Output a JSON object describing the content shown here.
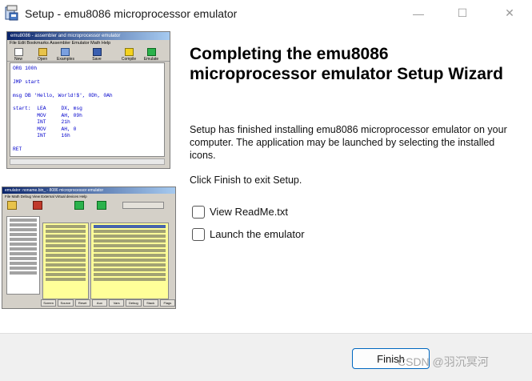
{
  "window": {
    "title": "Setup - emu8086 microprocessor emulator",
    "minimize_glyph": "—",
    "maximize_glyph": "☐",
    "close_glyph": "✕"
  },
  "wizard": {
    "heading": "Completing the emu8086 microprocessor emulator Setup Wizard",
    "body": "Setup has finished installing emu8086 microprocessor emulator on your computer. The application may be launched by selecting the installed icons.",
    "finish_instruction": "Click Finish to exit Setup.",
    "options": [
      {
        "label": "View ReadMe.txt",
        "checked": false
      },
      {
        "label": "Launch the emulator",
        "checked": false
      }
    ],
    "finish_button": "Finish"
  },
  "screenshot_editor": {
    "title": "emu8086 - assembler and microprocessor emulator",
    "menu": "File  Edit  Bookmarks  Assembler  Emulator  Math  Help",
    "tools": [
      "New",
      "Open",
      "Examples",
      "Save",
      "Compile",
      "Emulate"
    ],
    "code": "ORG 100h\n\nJMP start\n\nmsg DB 'Hello, World!$', 0Dh, 0Ah\n\nstart:  LEA     DX, msg\n        MOV     AH, 09h\n        INT     21h\n        MOV     AH, 0\n        INT     16h\n\nRET"
  },
  "screenshot_emulator": {
    "title": "emulator: noname.bin_ - 8086 microprocessor emulator",
    "menu": "File  Math  Debug  View  External  Virtual devices  Help",
    "bottom_buttons": [
      "Screen",
      "Source",
      "Reset",
      "Aux",
      "Vars",
      "Debug",
      "Stack",
      "Flags"
    ]
  },
  "watermark": "CSDN @羽沉冥河"
}
